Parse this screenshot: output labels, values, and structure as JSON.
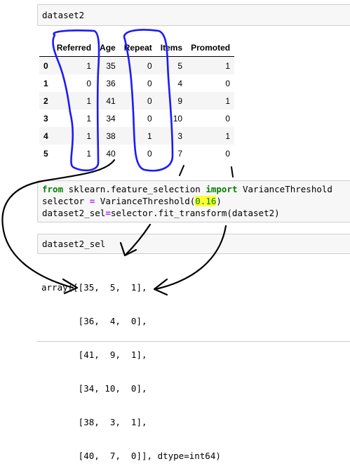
{
  "cell1": {
    "code": "dataset2"
  },
  "table": {
    "columns": [
      "Referred",
      "Age",
      "Repeat",
      "Items",
      "Promoted"
    ],
    "rows": [
      {
        "index": "0",
        "values": [
          "1",
          "35",
          "0",
          "5",
          "1"
        ]
      },
      {
        "index": "1",
        "values": [
          "0",
          "36",
          "0",
          "4",
          "0"
        ]
      },
      {
        "index": "2",
        "values": [
          "1",
          "41",
          "0",
          "9",
          "1"
        ]
      },
      {
        "index": "3",
        "values": [
          "1",
          "34",
          "0",
          "10",
          "0"
        ]
      },
      {
        "index": "4",
        "values": [
          "1",
          "38",
          "1",
          "3",
          "1"
        ]
      },
      {
        "index": "5",
        "values": [
          "1",
          "40",
          "0",
          "7",
          "0"
        ]
      }
    ]
  },
  "cell2": {
    "line1": {
      "kw_from": "from",
      "module": " sklearn.feature_selection ",
      "kw_import": "import",
      "name": " VarianceThreshold"
    },
    "line2": {
      "pre": "selector ",
      "op": "=",
      "post": " VarianceThreshold(",
      "num": "0.16",
      "close": ")"
    },
    "line3": {
      "pre": "dataset2_sel",
      "op": "=",
      "post": "selector.fit_transform(dataset2)"
    }
  },
  "cell3": {
    "code": "dataset2_sel"
  },
  "output": {
    "lines": [
      "array([[35,  5,  1],",
      "       [36,  4,  0],",
      "       [41,  9,  1],",
      "       [34, 10,  0],",
      "       [38,  3,  1],",
      "       [40,  7,  0]], dtype=int64)"
    ]
  },
  "annotation_colors": {
    "circle": "#1a1aff",
    "arrow": "#000000",
    "highlight": "#ffff33"
  }
}
